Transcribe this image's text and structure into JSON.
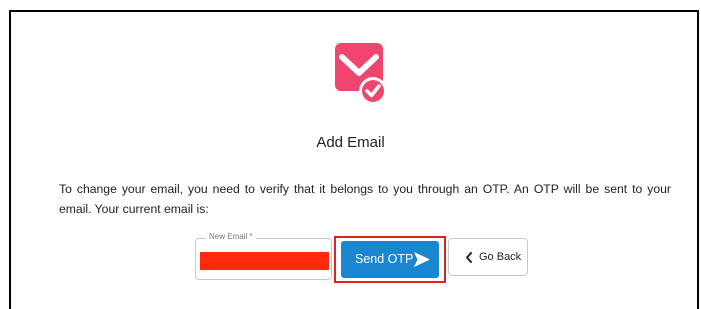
{
  "dialog": {
    "logo_icon": "email-check-icon",
    "title": "Add Email",
    "description": "To change your email, you need to verify that it belongs to you through an OTP. An OTP will be sent to your email. Your current email is:"
  },
  "form": {
    "email_label": "New Email *",
    "email_value": "",
    "email_highlight_color": "#ff2a10"
  },
  "buttons": {
    "send_otp": "Send OTP",
    "send_icon": "send-arrow-icon",
    "go_back": "Go Back",
    "back_icon": "chevron-left-icon"
  },
  "colors": {
    "brand_pink": "#f0456f",
    "primary_blue": "#1a86cf",
    "highlight_red": "#e2231a"
  }
}
